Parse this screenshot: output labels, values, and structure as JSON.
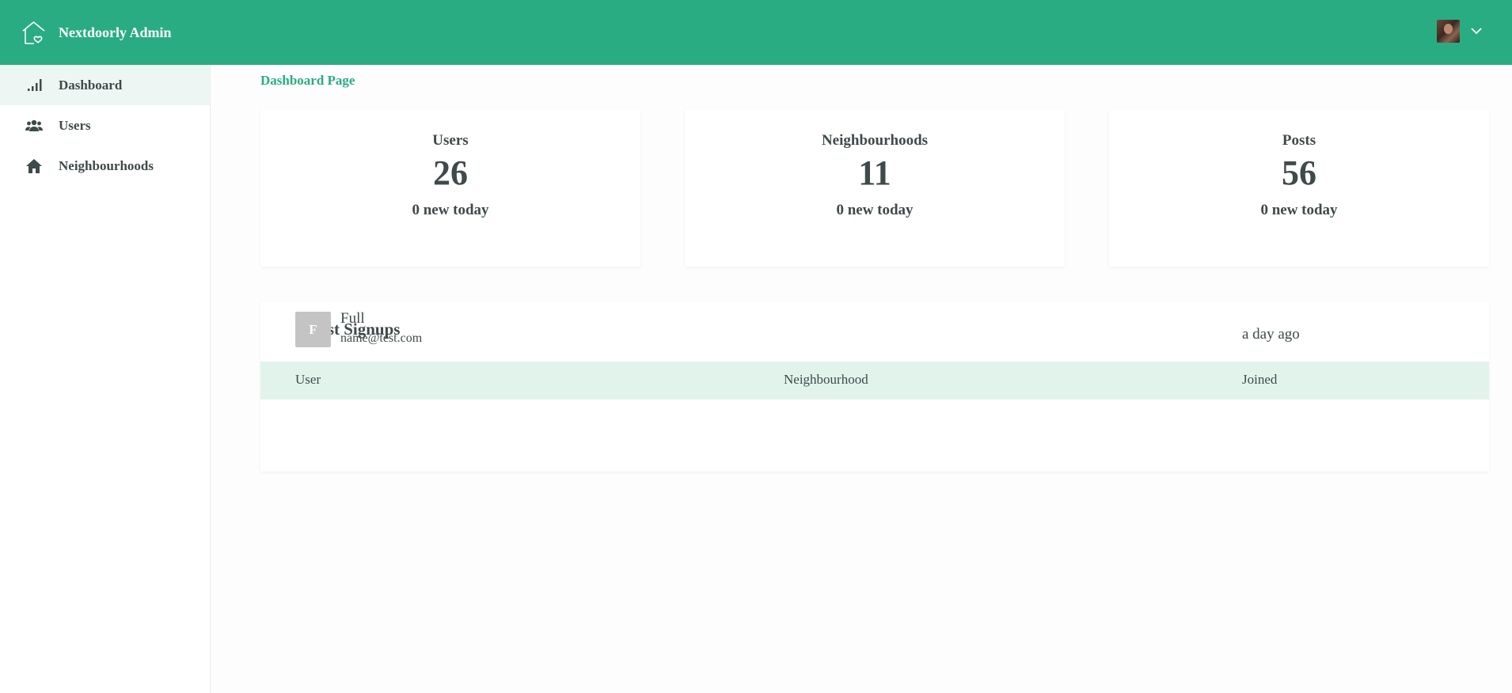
{
  "app": {
    "title": "Nextdoorly Admin"
  },
  "sidebar": {
    "items": [
      {
        "label": "Dashboard",
        "icon": "signal-bars-icon",
        "active": true
      },
      {
        "label": "Users",
        "icon": "users-icon",
        "active": false
      },
      {
        "label": "Neighbourhoods",
        "icon": "home-icon",
        "active": false
      }
    ]
  },
  "page": {
    "title": "Dashboard Page"
  },
  "stats": [
    {
      "label": "Users",
      "value": "26",
      "sub": "0 new today"
    },
    {
      "label": "Neighbourhoods",
      "value": "11",
      "sub": "0 new today"
    },
    {
      "label": "Posts",
      "value": "56",
      "sub": "0 new today"
    }
  ],
  "signups": {
    "title": "Latest Signups",
    "columns": [
      "User",
      "Neighbourhood",
      "Joined"
    ],
    "rows": [
      {
        "initial": "F",
        "name": "Full",
        "email": "name@test.com",
        "neighbourhood": "",
        "joined": "a day ago"
      }
    ]
  },
  "colors": {
    "brand": "#29ac82",
    "header_row": "#e2f3ec",
    "active_nav": "#eef6f3"
  }
}
